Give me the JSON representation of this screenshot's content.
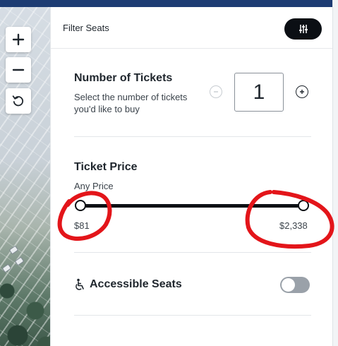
{
  "header": {
    "title": "Filter Seats",
    "filter_button_icon": "sliders-icon"
  },
  "map_controls": {
    "zoom_in_icon": "plus-icon",
    "zoom_out_icon": "minus-icon",
    "reset_icon": "rotate-ccw-icon"
  },
  "tickets": {
    "title": "Number of Tickets",
    "description": "Select the number of tickets you'd like to buy",
    "quantity": "1",
    "minus_icon": "minus-circle-icon",
    "plus_icon": "plus-circle-icon"
  },
  "price": {
    "title": "Ticket Price",
    "subtitle": "Any Price",
    "min_label": "$81",
    "max_label": "$2,338",
    "range_selected_fraction": [
      0,
      1
    ]
  },
  "accessible": {
    "icon": "wheelchair-icon",
    "label": "Accessible Seats",
    "toggle_on": false
  },
  "colors": {
    "brand_top_bar": "#1d3c73",
    "filter_button_bg": "#0b0f14",
    "slider_track": "#0b0f14",
    "toggle_off": "#9aa1a9",
    "annotation_red": "#e3151a"
  }
}
